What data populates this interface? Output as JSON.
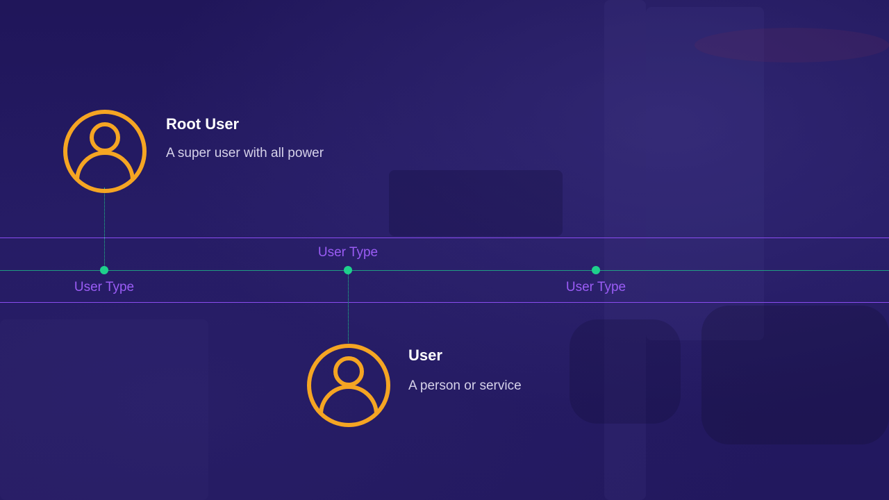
{
  "colors": {
    "background": "#1f1558",
    "accent_orange": "#f5a523",
    "band_purple": "#8a4cf0",
    "label_purple": "#9a5cf5",
    "timeline_green": "#1ed08c"
  },
  "nodes": [
    {
      "title": "Root User",
      "description": "A super user with all power",
      "icon": "user-avatar-icon"
    },
    {
      "title": "User",
      "description": "A person or service",
      "icon": "user-avatar-icon"
    }
  ],
  "timeline": {
    "labels": [
      "User Type",
      "User Type",
      "User Type"
    ]
  }
}
